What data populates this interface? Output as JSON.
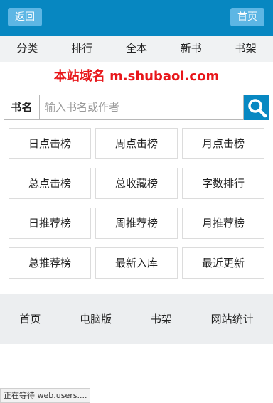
{
  "header": {
    "back_label": "返回",
    "home_label": "首页"
  },
  "nav": [
    "分类",
    "排行",
    "全本",
    "新书",
    "书架"
  ],
  "domain_notice": "本站域名 m.shubaol.com",
  "search": {
    "label": "书名",
    "placeholder": "输入书名或作者",
    "button_icon": "search-icon"
  },
  "rank_links": [
    "日点击榜",
    "周点击榜",
    "月点击榜",
    "总点击榜",
    "总收藏榜",
    "字数排行",
    "日推荐榜",
    "周推荐榜",
    "月推荐榜",
    "总推荐榜",
    "最新入库",
    "最近更新"
  ],
  "footer": [
    "首页",
    "电脑版",
    "书架",
    "网站统计"
  ],
  "status_text": "正在等待 web.users....",
  "colors": {
    "header_bg": "#0787c1",
    "header_button_bg": "#5db6e4",
    "domain_text": "#e8171b",
    "search_button_bg": "#0788c2"
  }
}
